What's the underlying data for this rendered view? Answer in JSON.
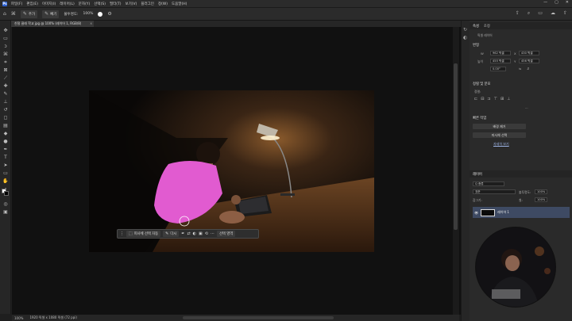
{
  "menubar": {
    "logo": "Ps",
    "items": [
      "파일(F)",
      "편집(E)",
      "이미지(I)",
      "레이어(L)",
      "문자(Y)",
      "선택(S)",
      "필터(T)",
      "보기(V)",
      "플러그인",
      "창(W)",
      "도움말(H)"
    ],
    "window_buttons": [
      "—",
      "▢",
      "✕"
    ]
  },
  "options": {
    "add_label": "추가",
    "remove_label": "빼기",
    "hardness_label": "불투명도:",
    "hardness_value": "100%"
  },
  "document": {
    "tab_title": "친절 클래 학교 jpg @ 100% (레이어 1, RGB/8)",
    "close": "×"
  },
  "contextual_bar": {
    "select_subject_label": "피사체 선택 자동",
    "feather_label": "선택 영역 무기",
    "brush_label": "다시",
    "select_mask_label": "선택 영역"
  },
  "status": {
    "zoom": "100%",
    "info": "1920 픽셀 x 1080 픽셀 (72 ppi)"
  },
  "properties_panel": {
    "tabs": [
      "속성",
      "조정"
    ],
    "doc_label": "픽셀 레이어",
    "transform_title": "변형",
    "w_label": "W",
    "w_value": "962 픽셀",
    "x_label": "X",
    "x_value": "430 픽셀",
    "h_label": "높이",
    "h_value": "455 픽셀",
    "y_label": "Y",
    "y_value": "456 픽셀",
    "angle_value": "0.00°",
    "align_title": "정렬 및 분포",
    "align_sub": "정렬:",
    "quick_title": "빠른 작업",
    "remove_bg": "배경 제거",
    "select_subject": "피사체 선택",
    "more_link": "자세히 보기"
  },
  "layers_panel": {
    "title": "레이어",
    "kind_label": "Q 종류",
    "blend_mode": "표준",
    "opacity_label": "불투명도:",
    "opacity_value": "100%",
    "lock_label": "잠그기:",
    "fill_label": "칠:",
    "fill_value": "100%",
    "layer_name": "레이어 1"
  },
  "colors": {
    "selection_overlay": "#e15bd0",
    "panel_bg": "#2a2a2a",
    "canvas_bg": "#111111"
  }
}
